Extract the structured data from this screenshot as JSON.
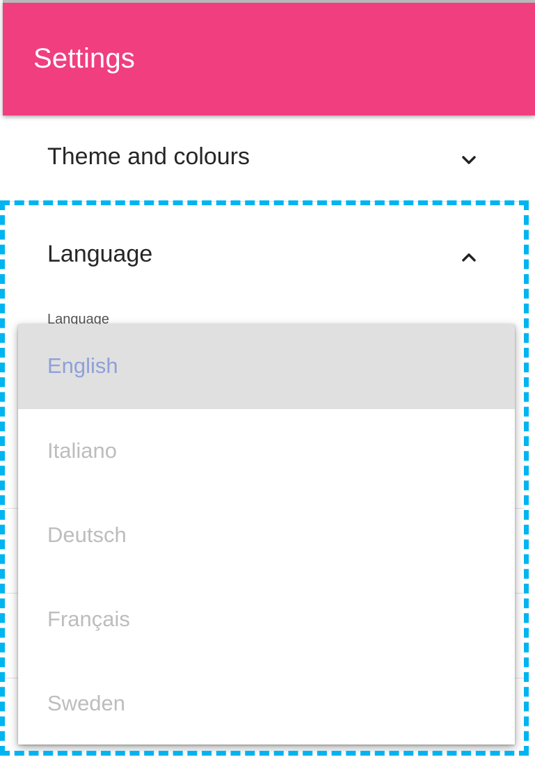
{
  "app_bar": {
    "title": "Settings",
    "color": "#f03e7f"
  },
  "panels": [
    {
      "title": "Theme and colours",
      "expanded": false,
      "icon": "chevron-down-icon"
    },
    {
      "title": "Language",
      "expanded": true,
      "icon": "chevron-up-icon"
    }
  ],
  "language_field": {
    "label": "Language",
    "selected": "English",
    "options": [
      "English",
      "Italiano",
      "Deutsch",
      "Français",
      "Sweden"
    ]
  },
  "colors": {
    "selection_outline": "#00b4f0",
    "selected_option_bg": "#e0e0e0",
    "selected_option_text": "#8fa0d8"
  }
}
